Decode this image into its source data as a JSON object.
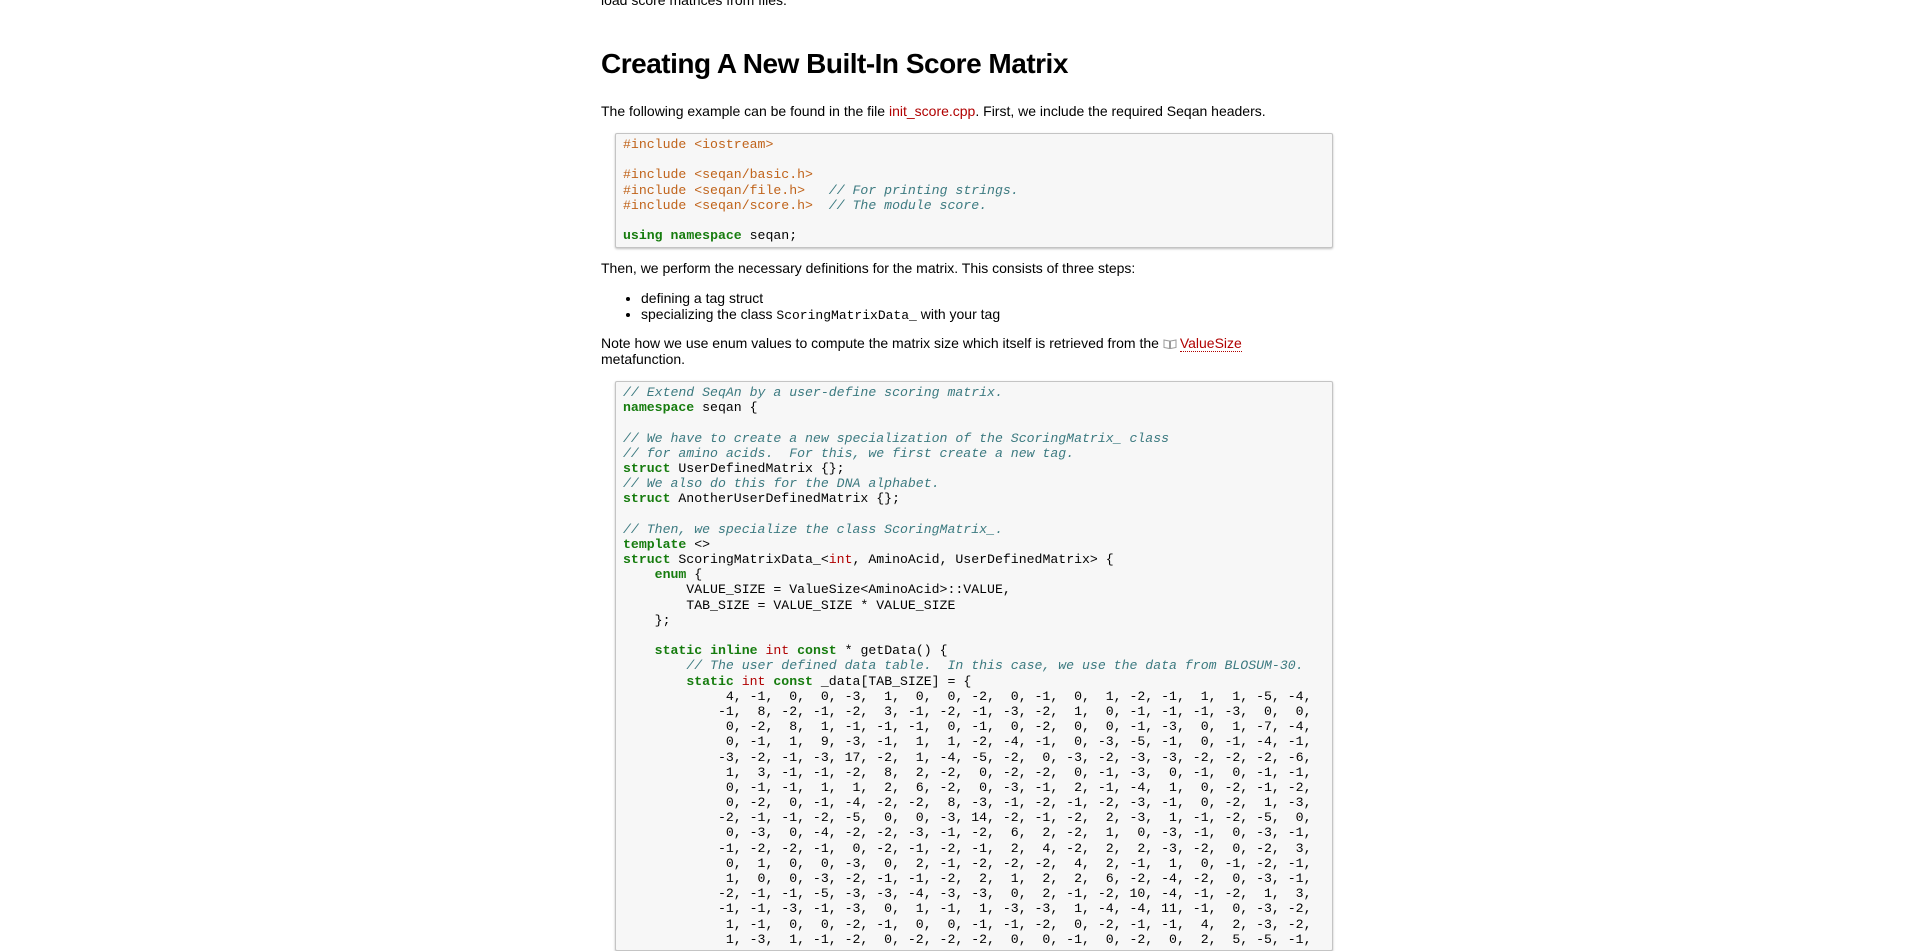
{
  "intro_tail": "load score matrices from files.",
  "heading": "Creating A New Built-In Score Matrix",
  "para1": {
    "before": "The following example can be found in the file ",
    "link": "init_score.cpp",
    "after": ". First, we include the required Seqan headers."
  },
  "code1": [
    [
      [
        "pp",
        "#include <iostream>"
      ]
    ],
    [],
    [
      [
        "pp",
        "#include <seqan/basic.h>"
      ]
    ],
    [
      [
        "pp",
        "#include <seqan/file.h>"
      ],
      [
        "",
        "   "
      ],
      [
        "cm",
        "// For printing strings."
      ]
    ],
    [
      [
        "pp",
        "#include <seqan/score.h>"
      ],
      [
        "",
        "  "
      ],
      [
        "cm",
        "// The module score."
      ]
    ],
    [],
    [
      [
        "kw",
        "using"
      ],
      [
        "",
        " "
      ],
      [
        "kw",
        "namespace"
      ],
      [
        "",
        " seqan;"
      ]
    ]
  ],
  "para2": "Then, we perform the necessary definitions for the matrix. This consists of three steps:",
  "bullets": {
    "item1": "defining a tag struct",
    "item2_before": "specializing the class ",
    "item2_code": "ScoringMatrixData_",
    "item2_after": " with your tag"
  },
  "para3": {
    "before": "Note how we use enum values to compute the matrix size which itself is retrieved from the ",
    "link": "ValueSize",
    "after": "metafunction."
  },
  "code2": [
    [
      [
        "cm",
        "// Extend SeqAn by a user-define scoring matrix."
      ]
    ],
    [
      [
        "kw",
        "namespace"
      ],
      [
        "",
        " seqan {"
      ]
    ],
    [],
    [
      [
        "cm",
        "// We have to create a new specialization of the ScoringMatrix_ class"
      ]
    ],
    [
      [
        "cm",
        "// for amino acids.  For this, we first create a new tag."
      ]
    ],
    [
      [
        "kw",
        "struct"
      ],
      [
        "",
        " UserDefinedMatrix {};"
      ]
    ],
    [
      [
        "cm",
        "// We also do this for the DNA alphabet."
      ]
    ],
    [
      [
        "kw",
        "struct"
      ],
      [
        "",
        " AnotherUserDefinedMatrix {};"
      ]
    ],
    [],
    [
      [
        "cm",
        "// Then, we specialize the class ScoringMatrix_."
      ]
    ],
    [
      [
        "kw",
        "template"
      ],
      [
        "",
        " <>"
      ]
    ],
    [
      [
        "kw",
        "struct"
      ],
      [
        "",
        " ScoringMatrixData_<"
      ],
      [
        "ty",
        "int"
      ],
      [
        "",
        ", AminoAcid, UserDefinedMatrix> {"
      ]
    ],
    [
      [
        "",
        "    "
      ],
      [
        "kw",
        "enum"
      ],
      [
        "",
        " {"
      ]
    ],
    [
      [
        "",
        "        VALUE_SIZE = ValueSize<AminoAcid>::VALUE,"
      ]
    ],
    [
      [
        "",
        "        TAB_SIZE = VALUE_SIZE * VALUE_SIZE"
      ]
    ],
    [
      [
        "",
        "    };"
      ]
    ],
    [],
    [
      [
        "",
        "    "
      ],
      [
        "kw",
        "static"
      ],
      [
        "",
        " "
      ],
      [
        "kw",
        "inline"
      ],
      [
        "",
        " "
      ],
      [
        "ty",
        "int"
      ],
      [
        "",
        " "
      ],
      [
        "kw",
        "const"
      ],
      [
        "",
        " * getData() {"
      ]
    ],
    [
      [
        "",
        "        "
      ],
      [
        "cm",
        "// The user defined data table.  In this case, we use the data from BLOSUM-30."
      ]
    ],
    [
      [
        "",
        "        "
      ],
      [
        "kw",
        "static"
      ],
      [
        "",
        " "
      ],
      [
        "ty",
        "int"
      ],
      [
        "",
        " "
      ],
      [
        "kw",
        "const"
      ],
      [
        "",
        " _data[TAB_SIZE] = {"
      ]
    ],
    [
      [
        "",
        "             4, -1,  0,  0, -3,  1,  0,  0, -2,  0, -1,  0,  1, -2, -1,  1,  1, -5, -4,"
      ]
    ],
    [
      [
        "",
        "            -1,  8, -2, -1, -2,  3, -1, -2, -1, -3, -2,  1,  0, -1, -1, -1, -3,  0,  0,"
      ]
    ],
    [
      [
        "",
        "             0, -2,  8,  1, -1, -1, -1,  0, -1,  0, -2,  0,  0, -1, -3,  0,  1, -7, -4,"
      ]
    ],
    [
      [
        "",
        "             0, -1,  1,  9, -3, -1,  1,  1, -2, -4, -1,  0, -3, -5, -1,  0, -1, -4, -1,"
      ]
    ],
    [
      [
        "",
        "            -3, -2, -1, -3, 17, -2,  1, -4, -5, -2,  0, -3, -2, -3, -3, -2, -2, -2, -6,"
      ]
    ],
    [
      [
        "",
        "             1,  3, -1, -1, -2,  8,  2, -2,  0, -2, -2,  0, -1, -3,  0, -1,  0, -1, -1,"
      ]
    ],
    [
      [
        "",
        "             0, -1, -1,  1,  1,  2,  6, -2,  0, -3, -1,  2, -1, -4,  1,  0, -2, -1, -2,"
      ]
    ],
    [
      [
        "",
        "             0, -2,  0, -1, -4, -2, -2,  8, -3, -1, -2, -1, -2, -3, -1,  0, -2,  1, -3,"
      ]
    ],
    [
      [
        "",
        "            -2, -1, -1, -2, -5,  0,  0, -3, 14, -2, -1, -2,  2, -3,  1, -1, -2, -5,  0,"
      ]
    ],
    [
      [
        "",
        "             0, -3,  0, -4, -2, -2, -3, -1, -2,  6,  2, -2,  1,  0, -3, -1,  0, -3, -1,"
      ]
    ],
    [
      [
        "",
        "            -1, -2, -2, -1,  0, -2, -1, -2, -1,  2,  4, -2,  2,  2, -3, -2,  0, -2,  3,"
      ]
    ],
    [
      [
        "",
        "             0,  1,  0,  0, -3,  0,  2, -1, -2, -2, -2,  4,  2, -1,  1,  0, -1, -2, -1,"
      ]
    ],
    [
      [
        "",
        "             1,  0,  0, -3, -2, -1, -1, -2,  2,  1,  2,  2,  6, -2, -4, -2,  0, -3, -1,"
      ]
    ],
    [
      [
        "",
        "            -2, -1, -1, -5, -3, -3, -4, -3, -3,  0,  2, -1, -2, 10, -4, -1, -2,  1,  3,"
      ]
    ],
    [
      [
        "",
        "            -1, -1, -3, -1, -3,  0,  1, -1,  1, -3, -3,  1, -4, -4, 11, -1,  0, -3, -2,"
      ]
    ],
    [
      [
        "",
        "             1, -1,  0,  0, -2, -1,  0,  0, -1, -1, -2,  0, -2, -1, -1,  4,  2, -3, -2,"
      ]
    ],
    [
      [
        "",
        "             1, -3,  1, -1, -2,  0, -2, -2, -2,  0,  0, -1,  0, -2,  0,  2,  5, -5, -1,"
      ]
    ]
  ]
}
